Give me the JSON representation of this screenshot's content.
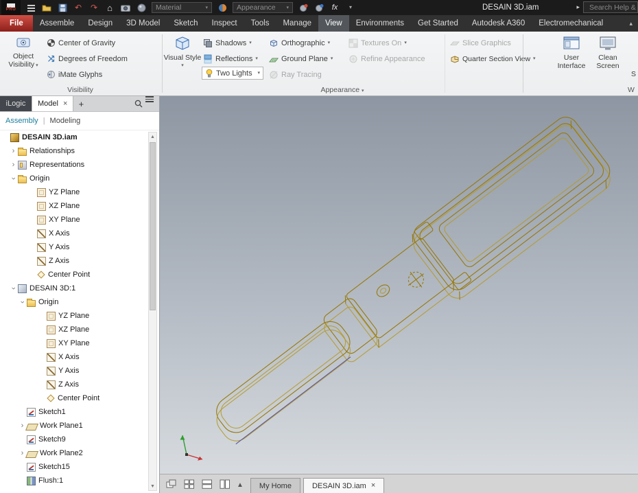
{
  "colors": {
    "wireframe": "#97790c",
    "file_tab": "#a8342f",
    "assembly_link": "#1b7f9e"
  },
  "titlebar": {
    "app_badge": "PRO",
    "material_combo": "Material",
    "appearance_combo": "Appearance",
    "fx_label": "fx",
    "title": "DESAIN 3D.iam",
    "search_placeholder": "Search Help &"
  },
  "tabbar": {
    "active": "View",
    "tabs": [
      {
        "label": "File"
      },
      {
        "label": "Assemble"
      },
      {
        "label": "Design"
      },
      {
        "label": "3D Model"
      },
      {
        "label": "Sketch"
      },
      {
        "label": "Inspect"
      },
      {
        "label": "Tools"
      },
      {
        "label": "Manage"
      },
      {
        "label": "View"
      },
      {
        "label": "Environments"
      },
      {
        "label": "Get Started"
      },
      {
        "label": "Autodesk A360"
      },
      {
        "label": "Electromechanical"
      }
    ]
  },
  "ribbon": {
    "visibility": {
      "object_visibility": "Object Visibility",
      "center_of_gravity": "Center of Gravity",
      "degrees_of_freedom": "Degrees of Freedom",
      "imate_glyphs": "iMate Glyphs",
      "label": "Visibility"
    },
    "appearance": {
      "visual_style": "Visual Style",
      "shadows": "Shadows",
      "reflections": "Reflections",
      "two_lights": "Two Lights",
      "orthographic": "Orthographic",
      "ground_plane": "Ground Plane",
      "ray_tracing": "Ray Tracing",
      "textures_on": "Textures On",
      "refine_appearance": "Refine Appearance",
      "slice_graphics": "Slice Graphics",
      "quarter_section_view": "Quarter Section View",
      "label": "Appearance"
    },
    "windows": {
      "user_interface": "User Interface",
      "clean_screen": "Clean Screen",
      "clipped_button": "S",
      "label": "W"
    }
  },
  "panel": {
    "tabs": {
      "ilogic": "iLogic",
      "model": "Model",
      "add": "+"
    },
    "modes": {
      "assembly": "Assembly",
      "divider": "|",
      "modeling": "Modeling"
    },
    "tree": {
      "items": [
        {
          "label": "DESAIN 3D.iam",
          "d": 0,
          "icon": "assembly",
          "bold": true
        },
        {
          "label": "Relationships",
          "d": 1,
          "exp": "c",
          "icon": "folder"
        },
        {
          "label": "Representations",
          "d": 1,
          "exp": "c",
          "icon": "repr"
        },
        {
          "label": "Origin",
          "d": 1,
          "exp": "o",
          "icon": "folder"
        },
        {
          "label": "YZ Plane",
          "d": 3,
          "icon": "plane"
        },
        {
          "label": "XZ Plane",
          "d": 3,
          "icon": "plane"
        },
        {
          "label": "XY Plane",
          "d": 3,
          "icon": "plane"
        },
        {
          "label": "X Axis",
          "d": 3,
          "icon": "axis"
        },
        {
          "label": "Y Axis",
          "d": 3,
          "icon": "axis"
        },
        {
          "label": "Z Axis",
          "d": 3,
          "icon": "axis"
        },
        {
          "label": "Center Point",
          "d": 3,
          "icon": "point"
        },
        {
          "label": "DESAIN 3D:1",
          "d": 1,
          "exp": "o",
          "icon": "part"
        },
        {
          "label": "Origin",
          "d": 2,
          "exp": "o",
          "icon": "folder"
        },
        {
          "label": "YZ Plane",
          "d": 4,
          "icon": "plane"
        },
        {
          "label": "XZ Plane",
          "d": 4,
          "icon": "plane"
        },
        {
          "label": "XY Plane",
          "d": 4,
          "icon": "plane"
        },
        {
          "label": "X Axis",
          "d": 4,
          "icon": "axis"
        },
        {
          "label": "Y Axis",
          "d": 4,
          "icon": "axis"
        },
        {
          "label": "Z Axis",
          "d": 4,
          "icon": "axis"
        },
        {
          "label": "Center Point",
          "d": 4,
          "icon": "point"
        },
        {
          "label": "Sketch1",
          "d": 2,
          "icon": "sketch"
        },
        {
          "label": "Work Plane1",
          "d": 2,
          "exp": "c",
          "icon": "workplane"
        },
        {
          "label": "Sketch9",
          "d": 2,
          "icon": "sketch"
        },
        {
          "label": "Work Plane2",
          "d": 2,
          "exp": "c",
          "icon": "workplane"
        },
        {
          "label": "Sketch15",
          "d": 2,
          "icon": "sketch"
        },
        {
          "label": "Flush:1",
          "d": 2,
          "icon": "flush"
        }
      ]
    }
  },
  "statusbar": {
    "tabs": [
      {
        "label": "My Home",
        "active": false
      },
      {
        "label": "DESAIN 3D.iam",
        "active": true
      }
    ]
  }
}
